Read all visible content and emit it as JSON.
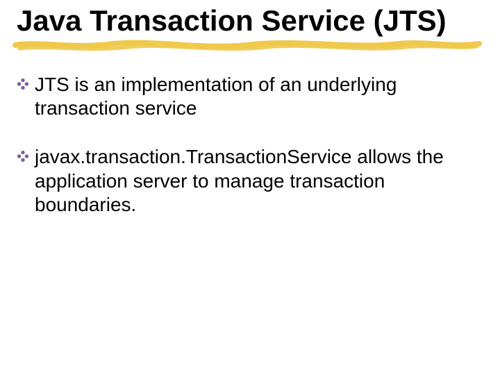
{
  "title": "Java Transaction Service (JTS)",
  "divider_color": "#f0c84a",
  "bullet_color": "#7a5fa0",
  "bullets": [
    "JTS is an implementation of an underlying transaction service",
    "javax.transaction.TransactionService allows the application server to manage transaction boundaries."
  ]
}
